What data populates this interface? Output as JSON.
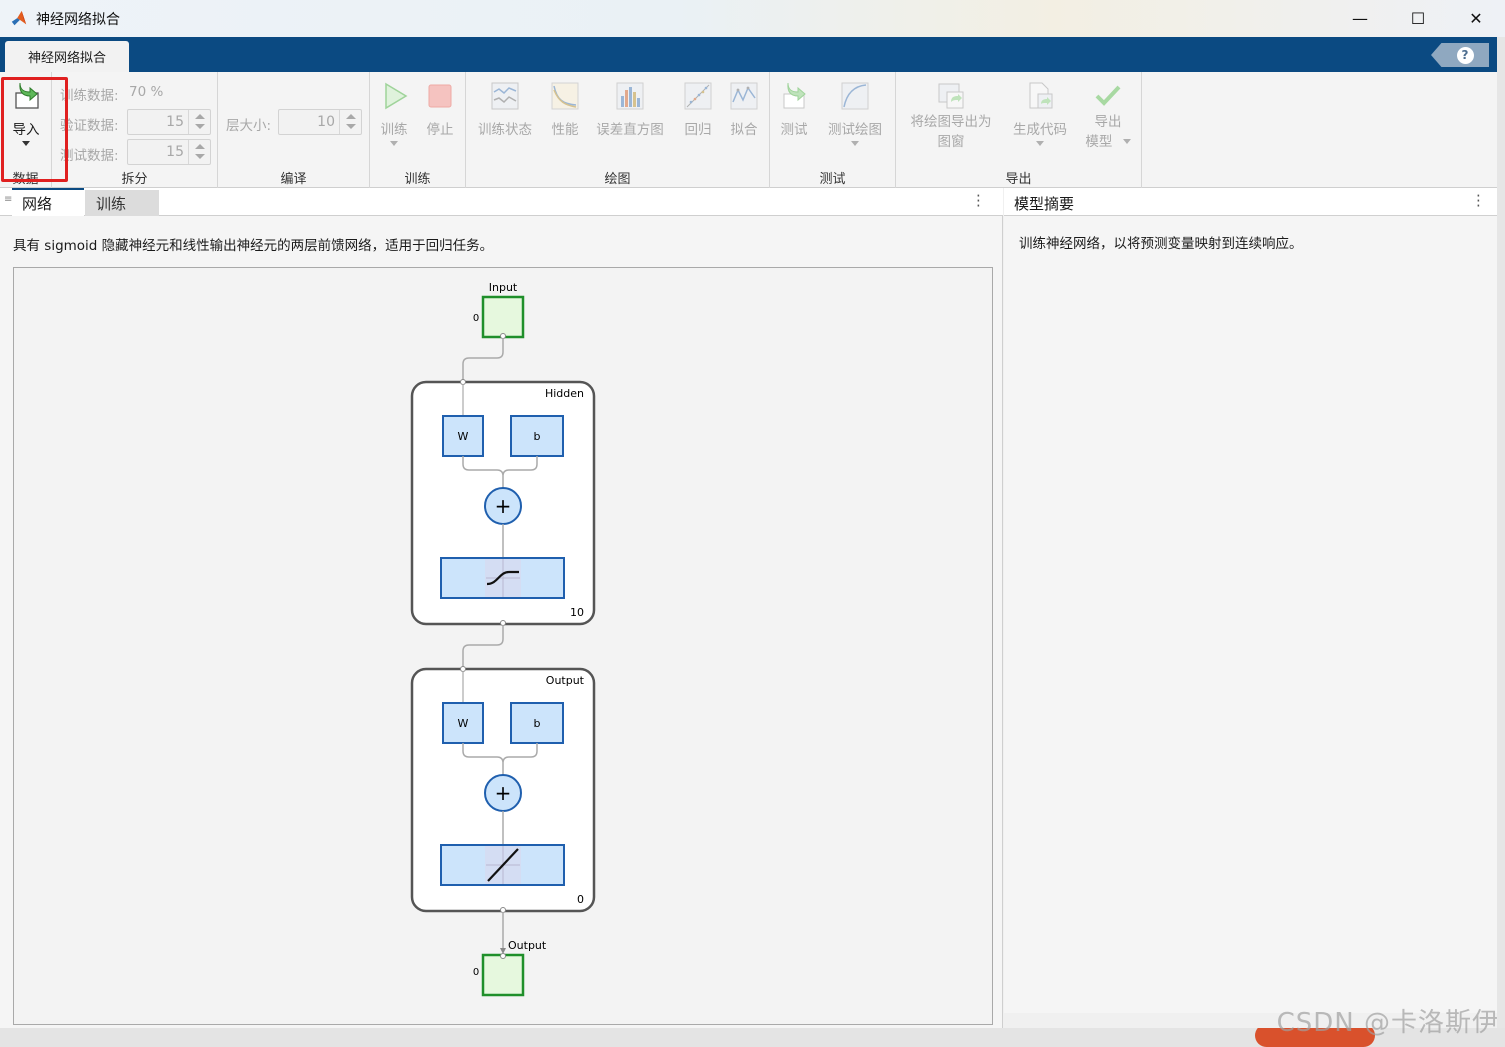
{
  "window": {
    "title": "神经网络拟合",
    "controls": [
      "—",
      "☐",
      "✕"
    ]
  },
  "ribbon": {
    "tab": "神经网络拟合",
    "help": "?"
  },
  "toolstrip": {
    "data_group": {
      "label": "数据",
      "import_label": "导入"
    },
    "split_group": {
      "label": "拆分",
      "train_label": "训练数据:",
      "train_value": "70 %",
      "val_label": "验证数据:",
      "val_value": "15",
      "test_label": "测试数据:",
      "test_value": "15"
    },
    "compile_group": {
      "label": "编译",
      "layer_label": "层大小:",
      "layer_value": "10"
    },
    "train_group": {
      "label": "训练",
      "train_label": "训练",
      "stop_label": "停止"
    },
    "plot_group": {
      "label": "绘图",
      "items": [
        "训练状态",
        "性能",
        "误差直方图",
        "回归",
        "拟合"
      ]
    },
    "test_group": {
      "label": "测试",
      "test_label": "测试",
      "testplot_label": "测试绘图"
    },
    "export_group": {
      "label": "导出",
      "export_fig_line1": "将绘图导出为",
      "export_fig_line2": "图窗",
      "gen_code_label": "生成代码",
      "export_model_line1": "导出",
      "export_model_line2": "模型"
    }
  },
  "left_panel": {
    "tabs": [
      "网络",
      "训练"
    ],
    "description": "具有 sigmoid 隐藏神经元和线性输出神经元的两层前馈网络，适用于回归任务。",
    "diagram": {
      "input_label": "Input",
      "input_size": "0",
      "hidden_label": "Hidden",
      "hidden_size": "10",
      "output_layer_label": "Output",
      "output_layer_size": "0",
      "output_label": "Output",
      "output_size": "0",
      "weight": "W",
      "bias": "b",
      "plus": "+"
    }
  },
  "right_panel": {
    "title": "模型摘要",
    "description": "训练神经网络，以将预测变量映射到连续响应。"
  },
  "watermark": "CSDN @卡洛斯伊",
  "colors": {
    "ribbon_blue": "#0b4a82",
    "node_blue": "#cce4fb",
    "node_border": "#1f5fae",
    "io_green": "#e6f8de",
    "io_border": "#1f8f2a",
    "highlight": "#e02020"
  }
}
